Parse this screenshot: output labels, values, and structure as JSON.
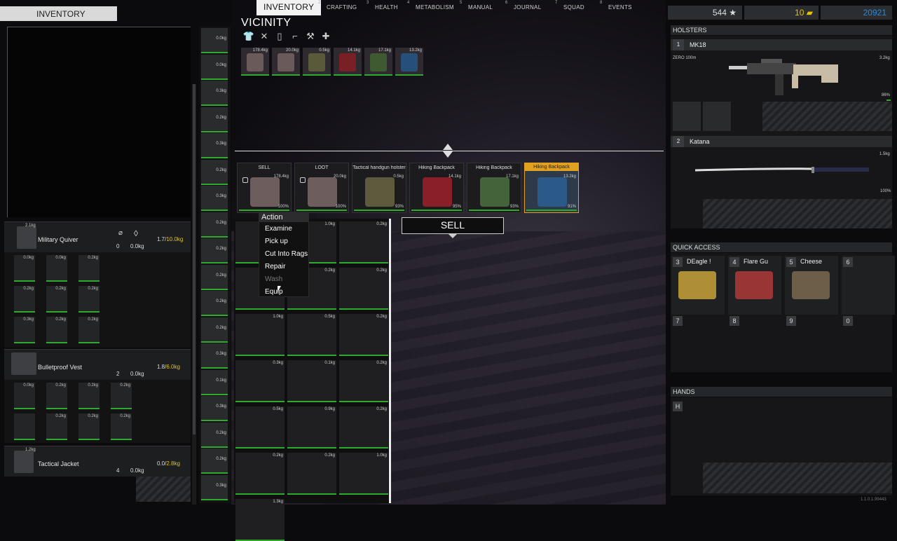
{
  "tabs": [
    {
      "num": "",
      "label": "INVENTORY",
      "active": true
    },
    {
      "num": "2",
      "label": "CRAFTING"
    },
    {
      "num": "3",
      "label": "HEALTH"
    },
    {
      "num": "4",
      "label": "METABOLISM"
    },
    {
      "num": "5",
      "label": "MANUAL"
    },
    {
      "num": "6",
      "label": "JOURNAL"
    },
    {
      "num": "7",
      "label": "SQUAD"
    },
    {
      "num": "8",
      "label": "EVENTS"
    }
  ],
  "stats": {
    "fame": "544 ★",
    "gold": "10",
    "money": "20921",
    "gold_color": "#e6c200",
    "money_color": "#2a8bd8"
  },
  "inventory": {
    "title": "INVENTORY",
    "containers": [
      {
        "name": "Military Quiver",
        "weight_badge": "2.1kg",
        "count": "0",
        "weight": "0.0kg",
        "cap_used": "1.7/",
        "cap_max": "10.0kg"
      },
      {
        "name": "Bulletproof Vest",
        "weight_badge": "",
        "count": "2",
        "weight": "0.0kg",
        "cap_used": "1.8/",
        "cap_max": "6.0kg"
      },
      {
        "name": "Tactical Jacket",
        "weight_badge": "1.2kg",
        "count": "4",
        "weight": "0.0kg",
        "cap_used": "0.0/",
        "cap_max": "2.8kg"
      }
    ],
    "quiver_slots": [
      {
        "w": "0.0kg"
      },
      {
        "w": "0.0kg"
      },
      {
        "w": "0.2kg"
      },
      {
        "w": "0.2kg"
      },
      {
        "w": "0.2kg"
      },
      {
        "w": "0.2kg"
      },
      {
        "w": "0.3kg"
      },
      {
        "w": "0.2kg"
      },
      {
        "w": "0.2kg"
      }
    ],
    "vest_slots": [
      {
        "w": "0.0kg"
      },
      {
        "w": "0.2kg"
      },
      {
        "w": "0.2kg"
      },
      {
        "w": "0.2kg"
      },
      {
        "w": ""
      },
      {
        "w": "0.2kg"
      },
      {
        "w": "0.2kg"
      },
      {
        "w": "0.2kg"
      }
    ]
  },
  "side_column": [
    {
      "w": "0.0kg"
    },
    {
      "w": "0.0kg"
    },
    {
      "w": "0.3kg"
    },
    {
      "w": "0.2kg"
    },
    {
      "w": "0.3kg"
    },
    {
      "w": "0.2kg"
    },
    {
      "w": "0.3kg"
    },
    {
      "w": "0.2kg"
    },
    {
      "w": "0.2kg"
    },
    {
      "w": "0.2kg"
    },
    {
      "w": "0.2kg"
    },
    {
      "w": "0.2kg"
    },
    {
      "w": "0.3kg"
    },
    {
      "w": "0.1kg"
    },
    {
      "w": "0.3kg"
    },
    {
      "w": "0.2kg"
    },
    {
      "w": "0.2kg"
    },
    {
      "w": "0.3kg"
    }
  ],
  "vicinity": {
    "title": "VICINITY",
    "icons": [
      "shirt-icon",
      "cross-icon",
      "bottle-icon",
      "gun-icon",
      "wrench-icon",
      "plus-icon"
    ],
    "icon_glyphs": [
      "👕",
      "✕",
      "▯",
      "⌐",
      "⚒",
      "✚"
    ],
    "items": [
      {
        "w": "178.4kg",
        "color": "#6a5a5a"
      },
      {
        "w": "20.0kg",
        "color": "#6a5a5a"
      },
      {
        "w": "0.5kg",
        "color": "#5a5a3a"
      },
      {
        "w": "14.1kg",
        "color": "#7a1f25"
      },
      {
        "w": "17.1kg",
        "color": "#3f5a30"
      },
      {
        "w": "13.2kg",
        "color": "#26507a"
      }
    ]
  },
  "trader_slots": [
    {
      "label": "SELL",
      "w": "178.4kg",
      "pct": "100%",
      "color": "#6d5d5d",
      "locked": true
    },
    {
      "label": "LOOT",
      "w": "20.0kg",
      "pct": "100%",
      "color": "#6d5d5d",
      "locked": true
    },
    {
      "label": "Tactical handgun holster",
      "w": "0.5kg",
      "pct": "93%",
      "color": "#5e5a3e",
      "locked": false
    },
    {
      "label": "Hiking Backpack",
      "w": "14.1kg",
      "pct": "95%",
      "color": "#8a1f28",
      "locked": false
    },
    {
      "label": "Hiking Backpack",
      "w": "17.1kg",
      "pct": "93%",
      "color": "#44633a",
      "locked": false
    },
    {
      "label": "Hiking Backpack",
      "w": "13.2kg",
      "pct": "91%",
      "color": "#2b5a88",
      "locked": false,
      "selected": true
    }
  ],
  "sell_label": "SELL",
  "context_menu": {
    "title": "Action",
    "options": [
      {
        "label": "Examine",
        "enabled": true
      },
      {
        "label": "Pick up",
        "enabled": true
      },
      {
        "label": "Cut Into Rags",
        "enabled": true
      },
      {
        "label": "Repair",
        "enabled": true
      },
      {
        "label": "Wash",
        "enabled": false
      },
      {
        "label": "Equip",
        "enabled": true
      }
    ]
  },
  "trader_items": [
    {
      "w": "0.2kg"
    },
    {
      "w": "1.0kg"
    },
    {
      "w": "0.2kg"
    },
    {
      "w": "1.0kg"
    },
    {
      "w": "0.2kg"
    },
    {
      "w": "0.2kg"
    },
    {
      "w": "1.0kg"
    },
    {
      "w": "0.5kg"
    },
    {
      "w": "0.2kg"
    },
    {
      "w": "0.3kg"
    },
    {
      "w": "0.1kg"
    },
    {
      "w": "0.2kg"
    },
    {
      "w": "0.5kg"
    },
    {
      "w": "0.9kg"
    },
    {
      "w": "0.2kg"
    },
    {
      "w": "0.2kg"
    },
    {
      "w": "0.2kg"
    },
    {
      "w": "1.0kg"
    },
    {
      "w": "1.3kg"
    }
  ],
  "holsters": {
    "title": "HOLSTERS",
    "weapons": [
      {
        "num": "1",
        "name": "MK18",
        "zero": "ZERO 100m",
        "weight": "3.2kg",
        "condition": "86%"
      },
      {
        "num": "2",
        "name": "Katana",
        "weight": "1.5kg",
        "condition": "100%"
      }
    ]
  },
  "quick_access": {
    "title": "QUICK ACCESS",
    "slots": [
      {
        "num": "3",
        "label": "DEagle !",
        "color": "#c9a33a"
      },
      {
        "num": "4",
        "label": "Flare Gu",
        "color": "#b03a3a"
      },
      {
        "num": "5",
        "label": "Cheese",
        "color": "#7a6a50"
      },
      {
        "num": "6",
        "label": "",
        "color": ""
      }
    ],
    "bottom": [
      "7",
      "8",
      "9",
      "0"
    ]
  },
  "hands": {
    "title": "HANDS",
    "slot": "H"
  },
  "version": "1.1.0.1.99443"
}
